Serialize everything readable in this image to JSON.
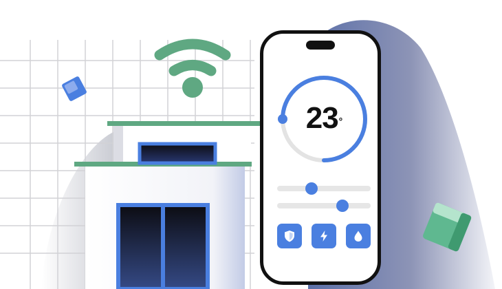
{
  "thermostat": {
    "temperature": "23",
    "degree_symbol": "°",
    "dial_progress": 0.75
  },
  "sliders": [
    {
      "name": "slider-1",
      "value": 0.37
    },
    {
      "name": "slider-2",
      "value": 0.7
    }
  ],
  "buttons": [
    {
      "icon": "shield-icon"
    },
    {
      "icon": "lightning-icon"
    },
    {
      "icon": "water-drop-icon"
    }
  ],
  "colors": {
    "accent": "#4a7fe0",
    "roof_green": "#5fa882",
    "cube_green": "#5fb890",
    "cube_blue": "#4a7fe0",
    "phone_frame": "#111111"
  }
}
